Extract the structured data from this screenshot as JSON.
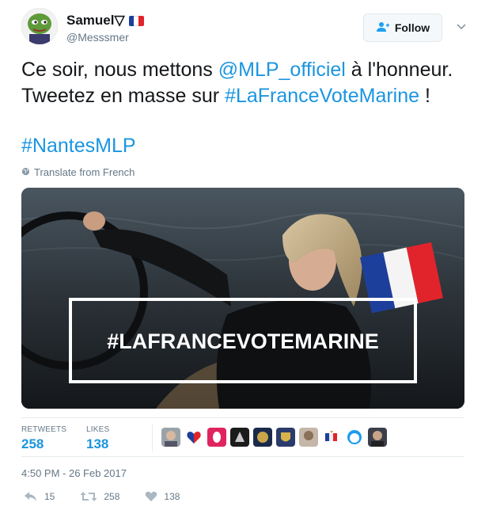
{
  "user": {
    "name": "Samuel▽",
    "handle": "@Messsmer",
    "flag_colors": [
      "#1d3f9c",
      "#ffffff",
      "#e1242b"
    ]
  },
  "follow_button": {
    "label": "Follow",
    "icon": "add-user-icon"
  },
  "tweet": {
    "line1_before": "Ce soir, nous mettons ",
    "mention": "@MLP_officiel",
    "line1_after": " à l'honneur.",
    "line2_before": "Tweetez en masse sur ",
    "hashtag1": "#LaFranceVoteMarine",
    "line2_after": " !",
    "hashtag2": "#NantesMLP"
  },
  "translate": {
    "label": "Translate from French",
    "icon": "globe-icon"
  },
  "media": {
    "overlay_text": "#LAFRANCEVOTEMARINE"
  },
  "stats": {
    "retweets_label": "RETWEETS",
    "retweets_value": "258",
    "likes_label": "LIKES",
    "likes_value": "138"
  },
  "timestamp": "4:50 PM - 26 Feb 2017",
  "actions": {
    "reply_count": "15",
    "retweet_count": "258",
    "like_count": "138"
  },
  "colors": {
    "link": "#1b95e0",
    "muted": "#657786",
    "text": "#14171a"
  }
}
